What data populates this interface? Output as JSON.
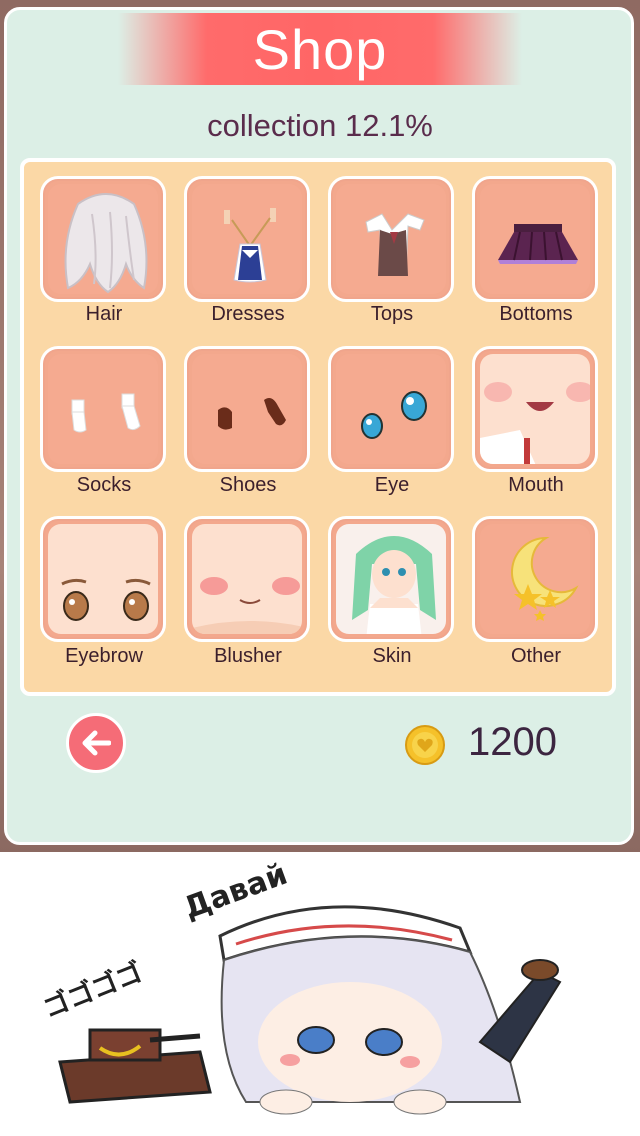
{
  "shop": {
    "title": "Shop",
    "collection_text": "collection 12.1%",
    "coins": "1200",
    "categories": [
      {
        "label": "Hair",
        "icon": "hair-icon"
      },
      {
        "label": "Dresses",
        "icon": "dress-icon"
      },
      {
        "label": "Tops",
        "icon": "top-icon"
      },
      {
        "label": "Bottoms",
        "icon": "skirt-icon"
      },
      {
        "label": "Socks",
        "icon": "socks-icon"
      },
      {
        "label": "Shoes",
        "icon": "shoes-icon"
      },
      {
        "label": "Eye",
        "icon": "eyes-icon"
      },
      {
        "label": "Mouth",
        "icon": "mouth-icon"
      },
      {
        "label": "Eyebrow",
        "icon": "eyebrow-icon"
      },
      {
        "label": "Blusher",
        "icon": "blusher-icon"
      },
      {
        "label": "Skin",
        "icon": "skin-icon"
      },
      {
        "label": "Other",
        "icon": "moon-stars-icon"
      }
    ]
  },
  "sticker": {
    "shout_text": "Давай",
    "sfx_text": "ゴゴゴゴ"
  },
  "colors": {
    "banner": "#ff6b6b",
    "panel": "#dcefe6",
    "board": "#fbd8a6",
    "tile": "#f5aa90",
    "back_button": "#f56c77",
    "coin": "#f5c12a"
  }
}
